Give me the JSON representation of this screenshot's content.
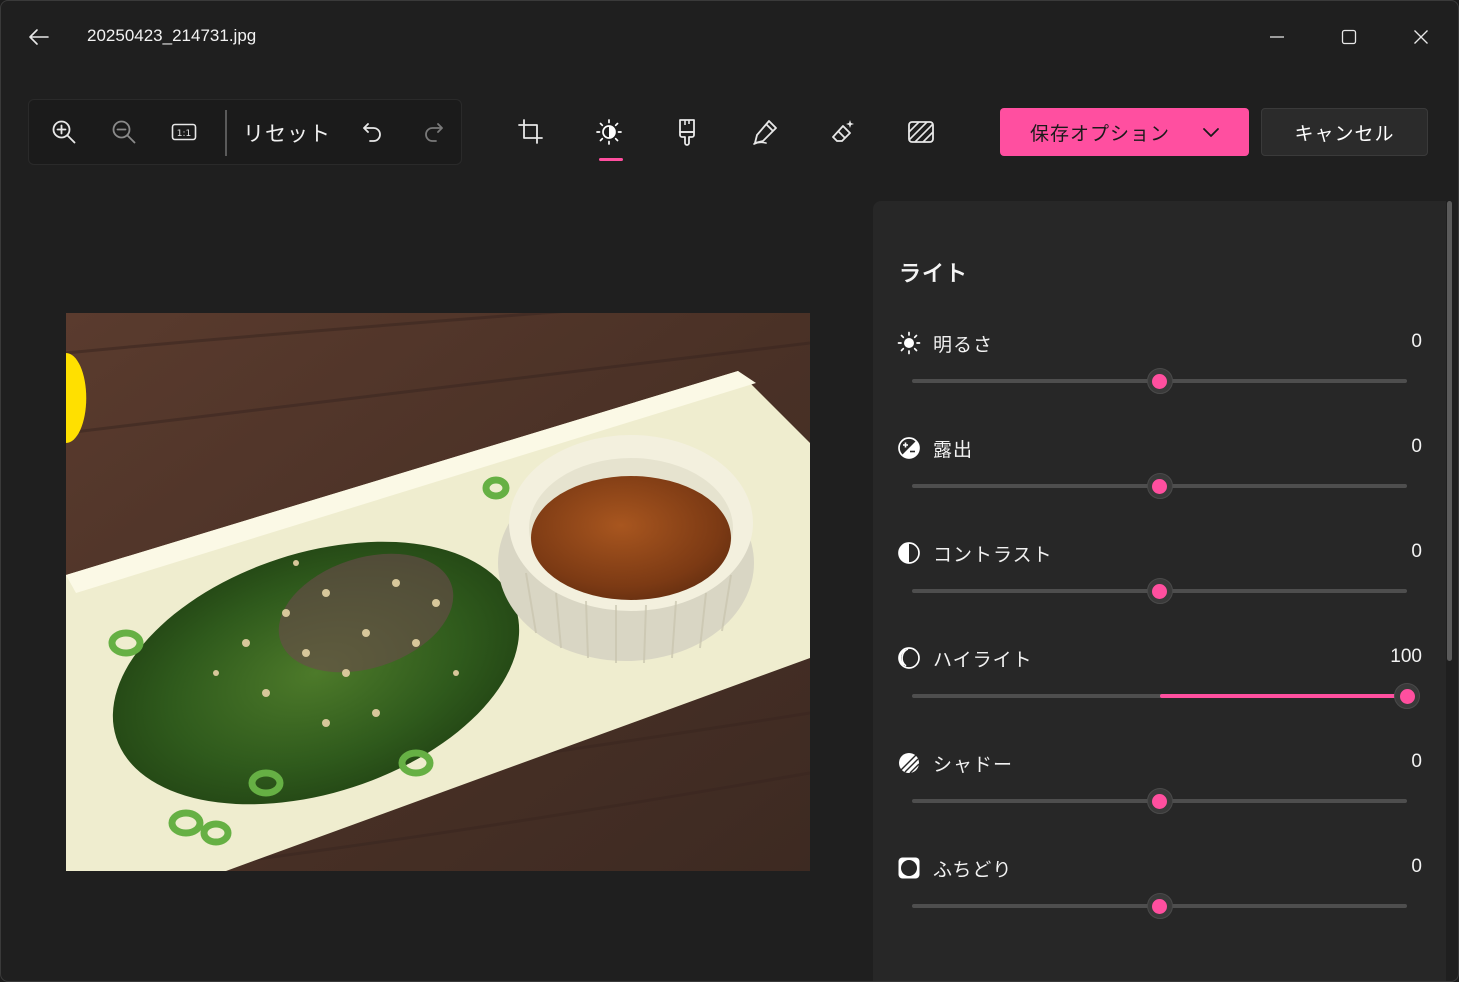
{
  "window": {
    "title": "20250423_214731.jpg"
  },
  "toolbar": {
    "reset_label": "リセット",
    "save_label": "保存オプション",
    "cancel_label": "キャンセル",
    "active_tool": "adjust",
    "accent": "#ff4f9f"
  },
  "panel": {
    "title": "ライト",
    "adjustments": [
      {
        "label": "明るさ",
        "value": "0",
        "icon": "brightness-icon",
        "fraction": 0.5
      },
      {
        "label": "露出",
        "value": "0",
        "icon": "exposure-icon",
        "fraction": 0.5
      },
      {
        "label": "コントラスト",
        "value": "0",
        "icon": "contrast-icon",
        "fraction": 0.5
      },
      {
        "label": "ハイライト",
        "value": "100",
        "icon": "highlight-icon",
        "fraction": 1.0
      },
      {
        "label": "シャドー",
        "value": "0",
        "icon": "shadow-icon",
        "fraction": 0.5
      },
      {
        "label": "ふちどり",
        "value": "0",
        "icon": "vignette-icon",
        "fraction": 0.5
      }
    ]
  }
}
